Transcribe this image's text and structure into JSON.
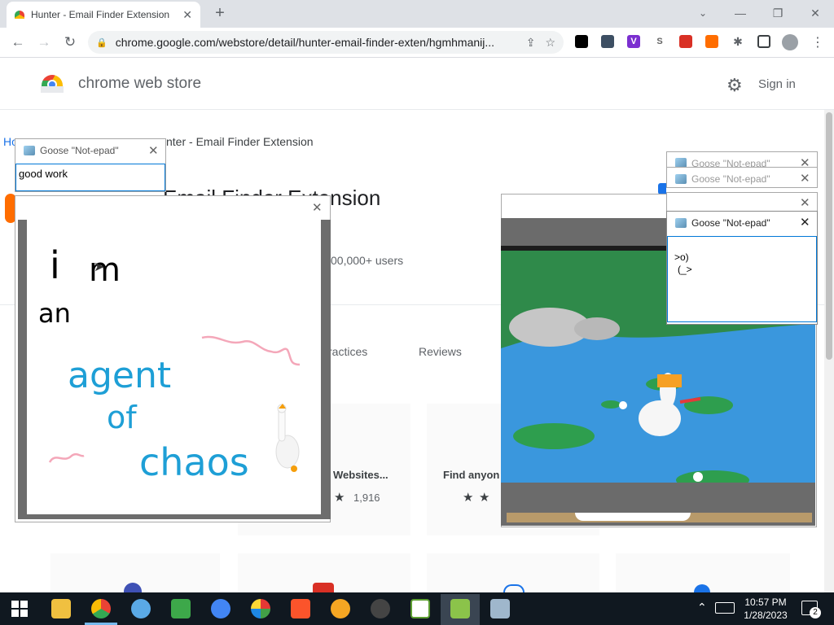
{
  "browser": {
    "tab_title": "Hunter - Email Finder Extension",
    "url": "chrome.google.com/webstore/detail/hunter-email-finder-exten/hgmhmanij...",
    "win_min": "—",
    "win_restore": "❐",
    "win_close": "✕",
    "new_tab": "+"
  },
  "store": {
    "title": "chrome web store",
    "sign_in": "Sign in",
    "breadcrumb_tail": "nter - Email Finder Extension",
    "breadcrumb_start": "Ho",
    "heading": "Email Finder Extension",
    "users": "00,000+ users",
    "tab_practices": "ractices",
    "tab_reviews": "Reviews",
    "card1_title": "Websites...",
    "card1_rating": "1,916",
    "card2_title": "Find anyon",
    "stars": "★"
  },
  "goose": {
    "notepad_title": "Goose \"Not-epad\"",
    "note1_text": "good work",
    "note4_line1": ">o)",
    "note4_line2": "(_>",
    "close": "✕"
  },
  "drawing": {
    "line1a": "i",
    "line1b": "m",
    "line2": "an",
    "line3": "agent",
    "line4": "of",
    "line5": "chaos"
  },
  "taskbar": {
    "time": "10:57 PM",
    "date": "1/28/2023",
    "notifications": "2"
  }
}
